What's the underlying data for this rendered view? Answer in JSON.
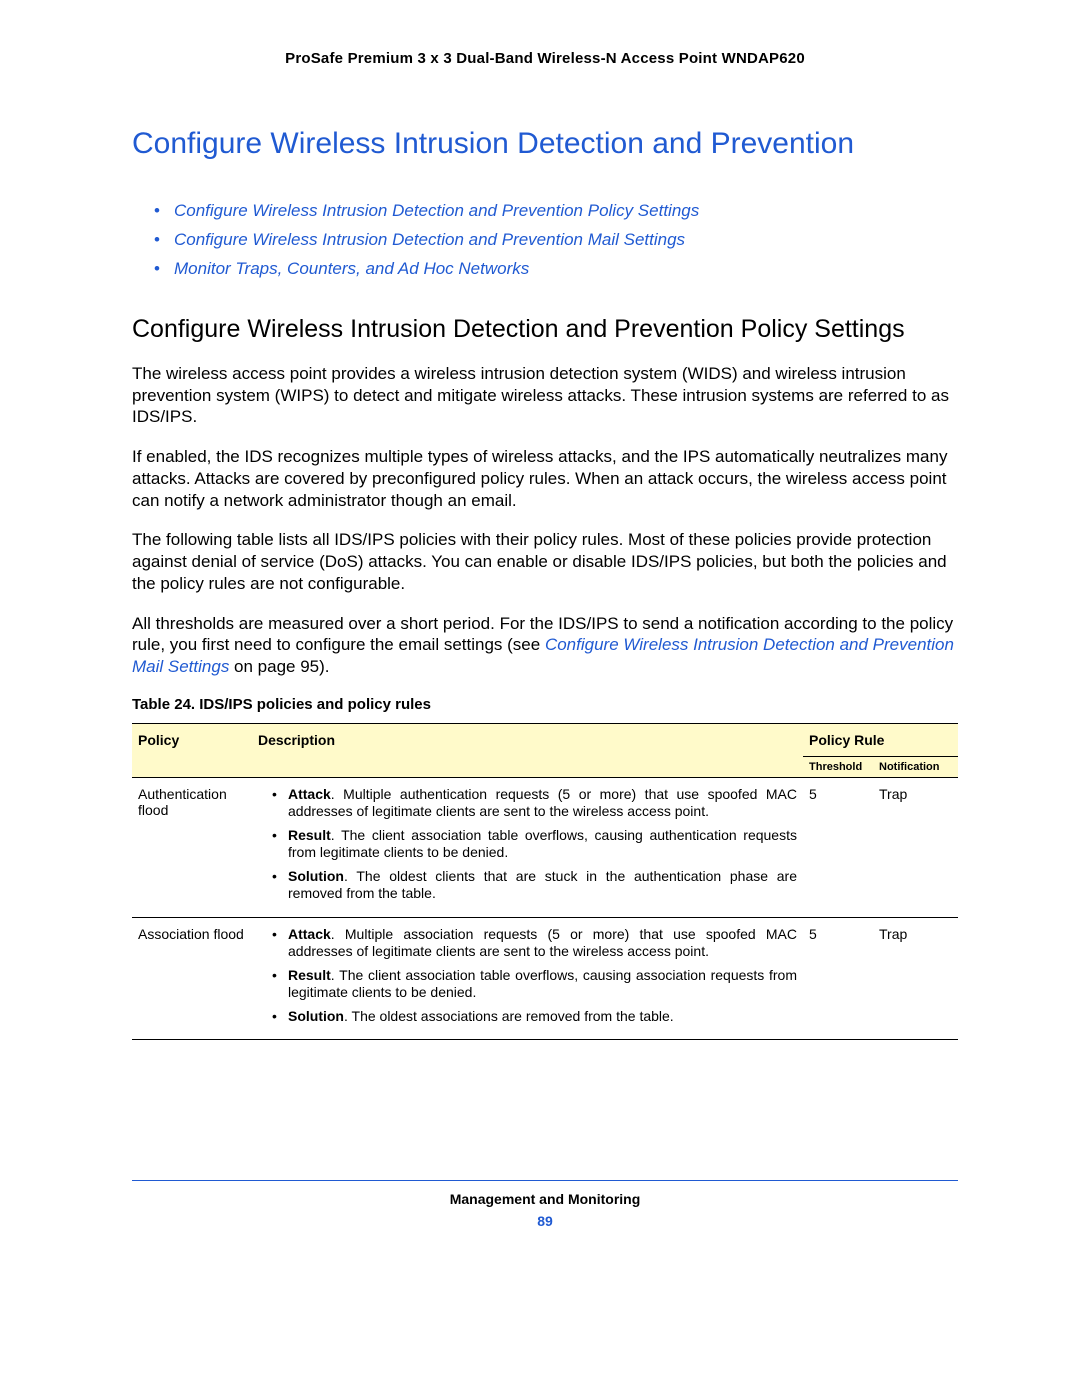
{
  "header": {
    "product": "ProSafe Premium 3 x 3 Dual-Band Wireless-N Access Point WNDAP620"
  },
  "title": "Configure Wireless Intrusion Detection and Prevention",
  "links": [
    "Configure Wireless Intrusion Detection and Prevention Policy Settings",
    "Configure Wireless Intrusion Detection and Prevention Mail Settings",
    "Monitor Traps, Counters, and Ad Hoc Networks"
  ],
  "subtitle": "Configure Wireless Intrusion Detection and Prevention Policy Settings",
  "paragraphs": {
    "p1": "The wireless access point provides a wireless intrusion detection system (WIDS) and wireless intrusion prevention system (WIPS) to detect and mitigate wireless attacks. These intrusion systems are referred to as IDS/IPS.",
    "p2": "If enabled, the IDS recognizes multiple types of wireless attacks, and the IPS automatically neutralizes many attacks. Attacks are covered by preconfigured policy rules. When an attack occurs, the wireless access point can notify a network administrator though an email.",
    "p3": "The following table lists all IDS/IPS policies with their policy rules. Most of these policies provide protection against denial of service (DoS) attacks. You can enable or disable IDS/IPS policies, but both the policies and the policy rules are not configurable.",
    "p4_pre": "All thresholds are measured over a short period. For the IDS/IPS to send a notification according to the policy rule, you first need to configure the email settings (see ",
    "p4_link": "Configure Wireless Intrusion Detection and Prevention Mail Settings",
    "p4_post": " on page 95)."
  },
  "table": {
    "caption": "Table 24.  IDS/IPS policies and policy rules",
    "headers": {
      "policy": "Policy",
      "description": "Description",
      "policy_rule": "Policy Rule",
      "threshold": "Threshold",
      "notification": "Notification"
    },
    "rows": [
      {
        "policy": "Authentication flood",
        "desc": [
          {
            "label": "Attack",
            "text": ". Multiple authentication requests (5 or more) that use spoofed MAC addresses of legitimate clients are sent to the wireless access point."
          },
          {
            "label": "Result",
            "text": ". The client association table overflows, causing authentication requests from legitimate clients to be denied."
          },
          {
            "label": "Solution",
            "text": ". The oldest clients that are stuck in the authentication phase are removed from the table."
          }
        ],
        "threshold": "5",
        "notification": "Trap"
      },
      {
        "policy": "Association flood",
        "desc": [
          {
            "label": "Attack",
            "text": ". Multiple association requests (5 or more) that use spoofed MAC addresses of legitimate clients are sent to the wireless access point."
          },
          {
            "label": "Result",
            "text": ". The client association table overflows, causing association requests from legitimate clients to be denied."
          },
          {
            "label": "Solution",
            "text": ". The oldest associations are removed from the table."
          }
        ],
        "threshold": "5",
        "notification": "Trap"
      }
    ]
  },
  "footer": {
    "section": "Management and Monitoring",
    "page": "89"
  }
}
